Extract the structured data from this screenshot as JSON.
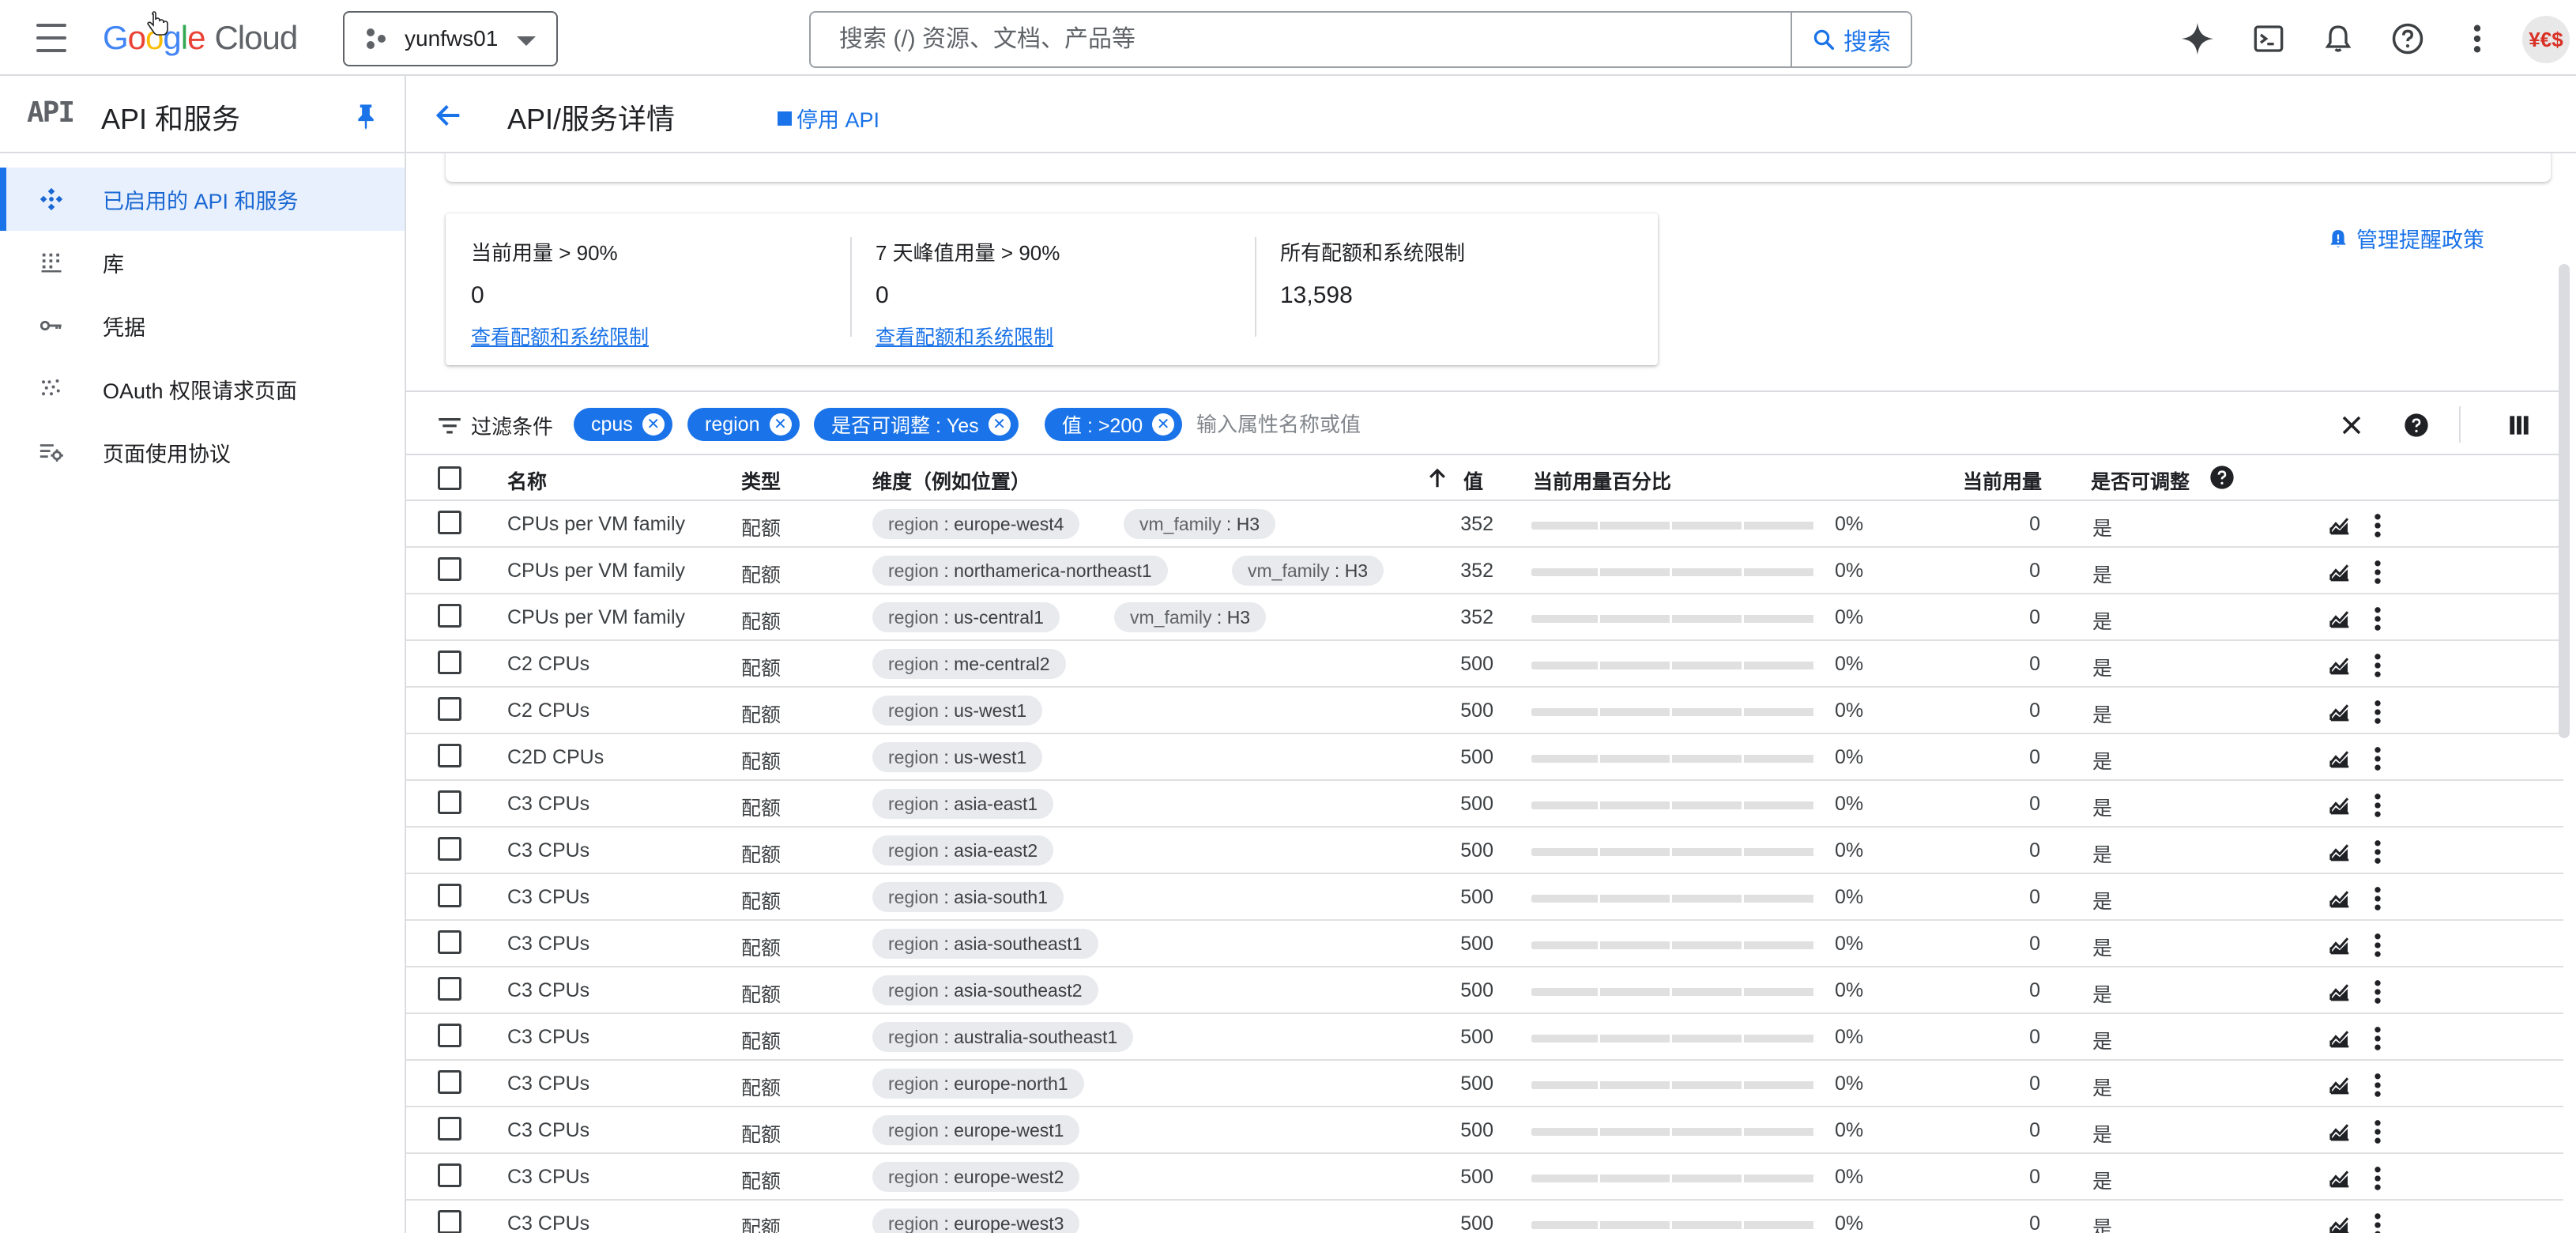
{
  "topbar": {
    "logo_text": "Google",
    "logo_suffix": "Cloud",
    "project_name": "yunfws01",
    "search_placeholder": "搜索 (/) 资源、文档、产品等",
    "search_button": "搜索",
    "avatar_text": "¥€$",
    "icons": [
      "hamburger-icon",
      "gemini-sparkle-icon",
      "cloud-shell-icon",
      "notifications-bell-icon",
      "help-icon",
      "more-vert-icon"
    ]
  },
  "leftnav": {
    "title": "API 和服务",
    "badge": "API",
    "items": [
      {
        "label": "已启用的 API 和服务",
        "icon": "api-hub-icon",
        "active": true
      },
      {
        "label": "库",
        "icon": "library-icon",
        "active": false
      },
      {
        "label": "凭据",
        "icon": "key-icon",
        "active": false
      },
      {
        "label": "OAuth 权限请求页面",
        "icon": "oauth-consent-icon",
        "active": false
      },
      {
        "label": "页面使用协议",
        "icon": "page-usage-settings-icon",
        "active": false
      }
    ]
  },
  "header": {
    "title": "API/服务详情",
    "disable_api": "停用 API"
  },
  "summary": {
    "current_usage": {
      "label": "当前用量 > 90%",
      "value": "0",
      "link": "查看配额和系统限制"
    },
    "peak_usage": {
      "label": "7 天峰值用量 > 90%",
      "value": "0",
      "link": "查看配额和系统限制"
    },
    "all_quotas": {
      "label": "所有配额和系统限制",
      "value": "13,598"
    },
    "manage_alerts": "管理提醒政策"
  },
  "filter": {
    "label": "过滤条件",
    "chips": [
      "cpus",
      "region",
      "是否可调整 : Yes",
      "值 : >200"
    ],
    "placeholder": "输入属性名称或值"
  },
  "table": {
    "columns": {
      "name": "名称",
      "type": "类型",
      "dimensions": "维度（例如位置）",
      "value": "值",
      "usage_pct": "当前用量百分比",
      "usage": "当前用量",
      "adjustable": "是否可调整"
    },
    "sort": {
      "column": "value",
      "direction": "ascending"
    },
    "rows": [
      {
        "name": "CPUs per VM family",
        "type": "配额",
        "dims": [
          {
            "k": "region",
            "v": "europe-west4"
          },
          {
            "k": "vm_family",
            "v": "H3"
          }
        ],
        "value": "352",
        "pct": "0%",
        "pct_value": 0,
        "usage": "0",
        "adjustable": "是"
      },
      {
        "name": "CPUs per VM family",
        "type": "配额",
        "dims": [
          {
            "k": "region",
            "v": "northamerica-northeast1"
          },
          {
            "k": "vm_family",
            "v": "H3"
          }
        ],
        "value": "352",
        "pct": "0%",
        "pct_value": 0,
        "usage": "0",
        "adjustable": "是"
      },
      {
        "name": "CPUs per VM family",
        "type": "配额",
        "dims": [
          {
            "k": "region",
            "v": "us-central1"
          },
          {
            "k": "vm_family",
            "v": "H3"
          }
        ],
        "value": "352",
        "pct": "0%",
        "pct_value": 0,
        "usage": "0",
        "adjustable": "是"
      },
      {
        "name": "C2 CPUs",
        "type": "配额",
        "dims": [
          {
            "k": "region",
            "v": "me-central2"
          }
        ],
        "value": "500",
        "pct": "0%",
        "pct_value": 0,
        "usage": "0",
        "adjustable": "是"
      },
      {
        "name": "C2 CPUs",
        "type": "配额",
        "dims": [
          {
            "k": "region",
            "v": "us-west1"
          }
        ],
        "value": "500",
        "pct": "0%",
        "pct_value": 0,
        "usage": "0",
        "adjustable": "是"
      },
      {
        "name": "C2D CPUs",
        "type": "配额",
        "dims": [
          {
            "k": "region",
            "v": "us-west1"
          }
        ],
        "value": "500",
        "pct": "0%",
        "pct_value": 0,
        "usage": "0",
        "adjustable": "是"
      },
      {
        "name": "C3 CPUs",
        "type": "配额",
        "dims": [
          {
            "k": "region",
            "v": "asia-east1"
          }
        ],
        "value": "500",
        "pct": "0%",
        "pct_value": 0,
        "usage": "0",
        "adjustable": "是"
      },
      {
        "name": "C3 CPUs",
        "type": "配额",
        "dims": [
          {
            "k": "region",
            "v": "asia-east2"
          }
        ],
        "value": "500",
        "pct": "0%",
        "pct_value": 0,
        "usage": "0",
        "adjustable": "是"
      },
      {
        "name": "C3 CPUs",
        "type": "配额",
        "dims": [
          {
            "k": "region",
            "v": "asia-south1"
          }
        ],
        "value": "500",
        "pct": "0%",
        "pct_value": 0,
        "usage": "0",
        "adjustable": "是"
      },
      {
        "name": "C3 CPUs",
        "type": "配额",
        "dims": [
          {
            "k": "region",
            "v": "asia-southeast1"
          }
        ],
        "value": "500",
        "pct": "0%",
        "pct_value": 0,
        "usage": "0",
        "adjustable": "是"
      },
      {
        "name": "C3 CPUs",
        "type": "配额",
        "dims": [
          {
            "k": "region",
            "v": "asia-southeast2"
          }
        ],
        "value": "500",
        "pct": "0%",
        "pct_value": 0,
        "usage": "0",
        "adjustable": "是"
      },
      {
        "name": "C3 CPUs",
        "type": "配额",
        "dims": [
          {
            "k": "region",
            "v": "australia-southeast1"
          }
        ],
        "value": "500",
        "pct": "0%",
        "pct_value": 0,
        "usage": "0",
        "adjustable": "是"
      },
      {
        "name": "C3 CPUs",
        "type": "配额",
        "dims": [
          {
            "k": "region",
            "v": "europe-north1"
          }
        ],
        "value": "500",
        "pct": "0%",
        "pct_value": 0,
        "usage": "0",
        "adjustable": "是"
      },
      {
        "name": "C3 CPUs",
        "type": "配额",
        "dims": [
          {
            "k": "region",
            "v": "europe-west1"
          }
        ],
        "value": "500",
        "pct": "0%",
        "pct_value": 0,
        "usage": "0",
        "adjustable": "是"
      },
      {
        "name": "C3 CPUs",
        "type": "配额",
        "dims": [
          {
            "k": "region",
            "v": "europe-west2"
          }
        ],
        "value": "500",
        "pct": "0%",
        "pct_value": 0,
        "usage": "0",
        "adjustable": "是"
      },
      {
        "name": "C3 CPUs",
        "type": "配额",
        "dims": [
          {
            "k": "region",
            "v": "europe-west3"
          }
        ],
        "value": "500",
        "pct": "0%",
        "pct_value": 0,
        "usage": "0",
        "adjustable": "是"
      }
    ]
  },
  "colors": {
    "accent": "#1a73e8",
    "active_nav_bg": "#e8f0fe",
    "chip_bg": "#e8eaed",
    "avatar_text": "#d93025"
  }
}
